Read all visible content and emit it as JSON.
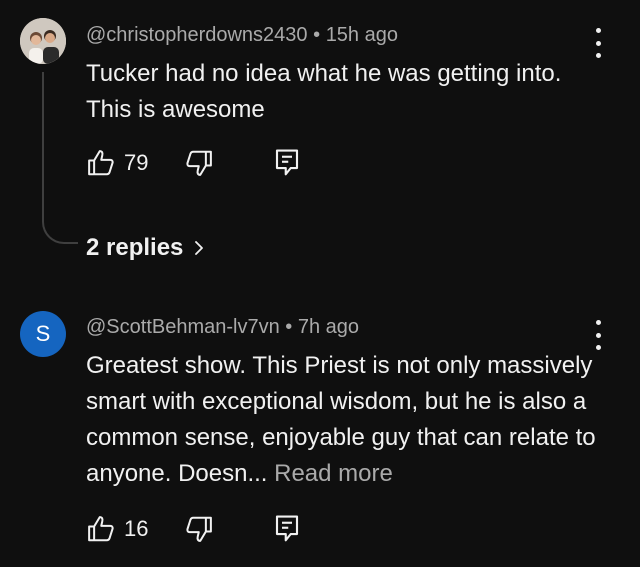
{
  "comments": [
    {
      "handle": "@christopherdowns2430",
      "separator": "•",
      "time": "15h ago",
      "text": "Tucker had no idea what he was getting into. This is awesome",
      "read_more": "",
      "likes": "79",
      "replies_label": "2 replies",
      "avatar_icon": "profile-photo"
    },
    {
      "handle": "@ScottBehman-lv7vn",
      "separator": "•",
      "time": "7h ago",
      "text": "Greatest show. This Priest is not only massively smart with exceptional wisdom, but he is also a common sense, enjoyable guy that can relate to anyone. Doesn...",
      "read_more": "Read more",
      "likes": "16",
      "avatar_letter": "S",
      "avatar_color": "#1565c0"
    }
  ],
  "icons": {
    "like": "thumbs-up-icon",
    "dislike": "thumbs-down-icon",
    "reply": "comment-reply-icon",
    "menu": "kebab-menu-icon",
    "chevron": "chevron-right-icon"
  },
  "colors": {
    "background": "#0f0f0f",
    "text_primary": "#f1f1f1",
    "text_secondary": "#aaaaaa"
  }
}
